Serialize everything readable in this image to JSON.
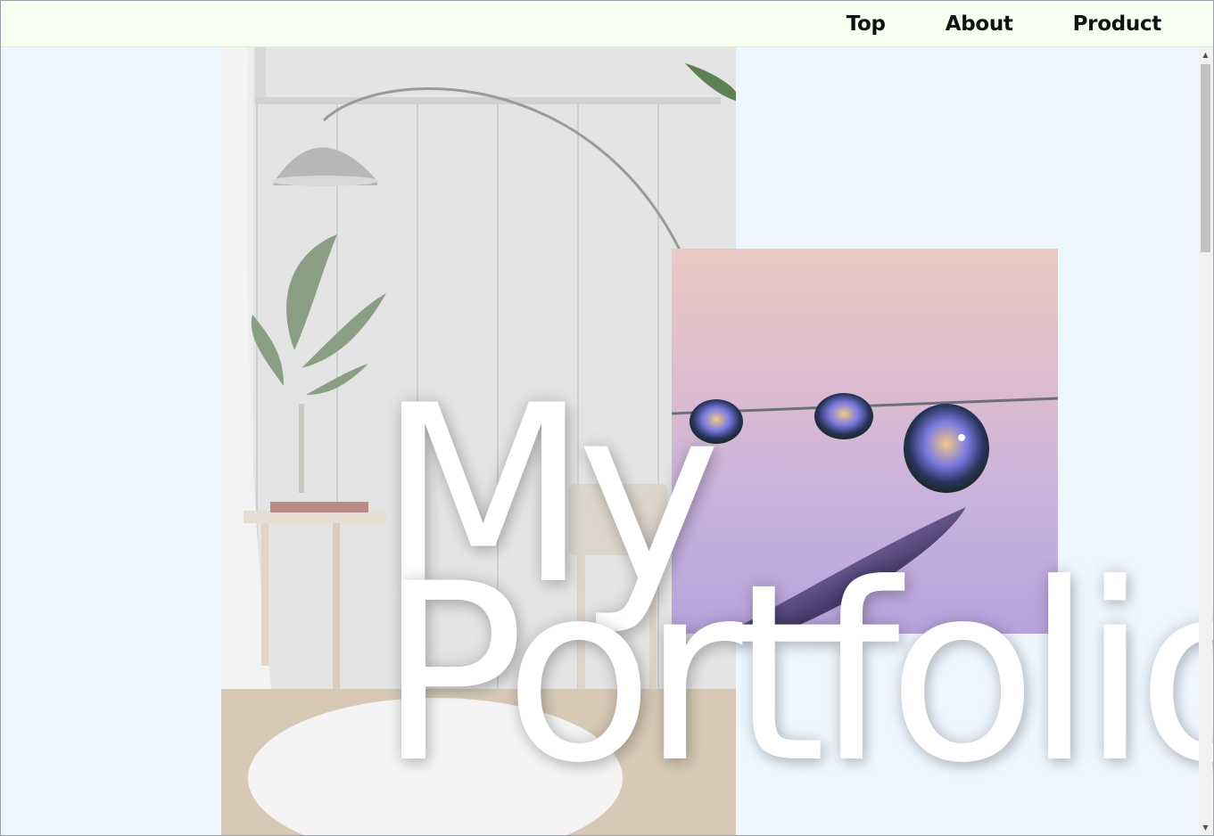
{
  "nav": {
    "items": [
      {
        "label": "Top"
      },
      {
        "label": "About"
      },
      {
        "label": "Product"
      }
    ]
  },
  "hero": {
    "title_line1": "My",
    "title_line2": "Portfolio"
  },
  "colors": {
    "header_bg": "#f7fff0",
    "page_bg": "#eef6ff",
    "title_color": "#ffffff"
  },
  "images": {
    "room_photo": "room-interior-photo",
    "drops_photo": "water-droplets-photo"
  },
  "scrollbar": {
    "up_icon": "▲",
    "down_icon": "▼"
  }
}
